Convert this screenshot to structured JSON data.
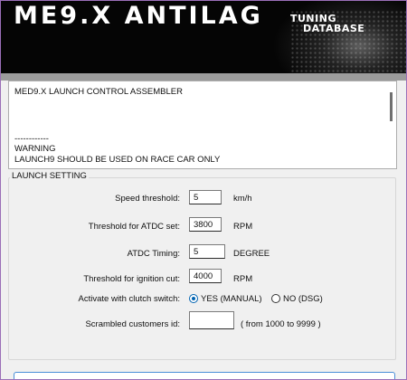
{
  "banner": {
    "title": "ME9.X ANTILAG",
    "logo_line1": "TUNING",
    "logo_line2": "DATABASE"
  },
  "log": {
    "lines": [
      "MED9.X LAUNCH CONTROL ASSEMBLER",
      "",
      "",
      "------------",
      "WARNING",
      "LAUNCH9 SHOULD BE USED ON RACE CAR ONLY"
    ]
  },
  "launch": {
    "legend": "LAUNCH SETTING",
    "speed": {
      "label": "Speed threshold:",
      "value": "5",
      "unit": "km/h"
    },
    "atdc_threshold": {
      "label": "Threshold for ATDC set:",
      "value": "3800",
      "unit": "RPM"
    },
    "atdc_timing": {
      "label": "ATDC Timing:",
      "value": "5",
      "unit": "DEGREE"
    },
    "ign_cut": {
      "label": "Threshold for ignition cut:",
      "value": "4000",
      "unit": "RPM"
    },
    "clutch": {
      "label": "Activate with clutch switch:",
      "opt_yes": "YES (MANUAL)",
      "opt_no": "NO (DSG)",
      "selected": "YES (MANUAL)"
    },
    "scrambled": {
      "label": "Scrambled customers id:",
      "value": "",
      "hint": "( from 1000 to 9999 )"
    }
  }
}
